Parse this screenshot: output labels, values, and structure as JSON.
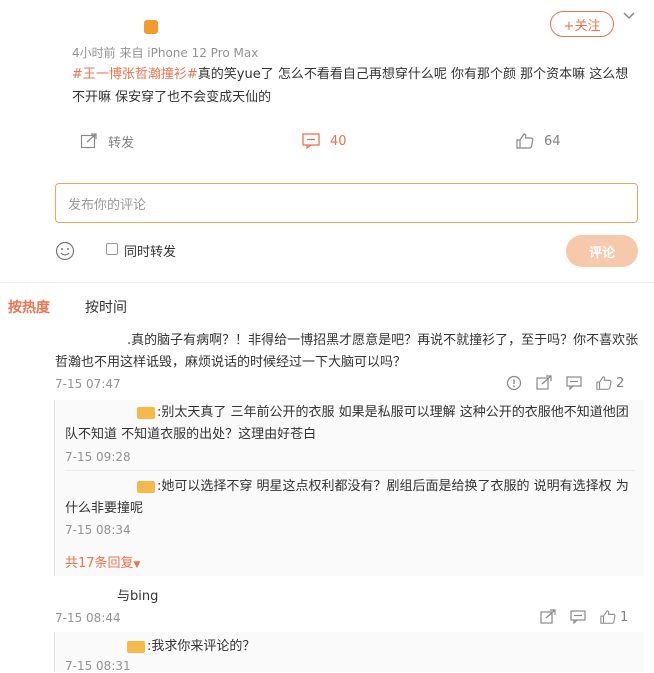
{
  "post": {
    "follow_label": "+关注",
    "meta": "4小时前 来自 iPhone 12 Pro Max",
    "topic": "#王一博张哲瀚撞衫#",
    "text": "真的笑yue了 怎么不看看自己再想穿什么呢 你有那个颜 那个资本嘛 这么想不开嘛 保安穿了也不会变成天仙的",
    "actions": {
      "repost_label": "转发",
      "comment_count": "40",
      "like_count": "64"
    }
  },
  "composer": {
    "placeholder": "发布你的评论",
    "also_repost_label": "同时转发",
    "submit_label": "评论"
  },
  "sort_tabs": {
    "hot": "按热度",
    "time": "按时间"
  },
  "comments": [
    {
      "text": ".真的脑子有病啊？！非得给一博招黑才愿意是吧？再说不就撞衫了，至于吗？你不喜欢张哲瀚也不用这样诋毁，麻烦说话的时候经过一下大脑可以吗？",
      "date": "7-15 07:47",
      "like_count": "2",
      "replies": [
        {
          "text": ":别太天真了 三年前公开的衣服 如果是私服可以理解 这种公开的衣服他不知道他团队不知道 不知道衣服的出处？这理由好苍白",
          "date": "7-15 09:28"
        },
        {
          "text": ":她可以选择不穿 明星这点权利都没有？剧组后面是给换了衣服的 说明有选择权 为什么非要撞呢",
          "date": "7-15 08:34"
        }
      ],
      "more_replies_label": "共17条回复"
    },
    {
      "text": "与bing",
      "date": "7-15 08:44",
      "like_count": "1",
      "replies": [
        {
          "text": ":我求你来评论的？",
          "date": "7-15 08:31"
        }
      ]
    }
  ],
  "colors": {
    "accent": "#eb7350",
    "submit_disabled": "#f6c9ad",
    "input_border": "#f0a35a"
  }
}
